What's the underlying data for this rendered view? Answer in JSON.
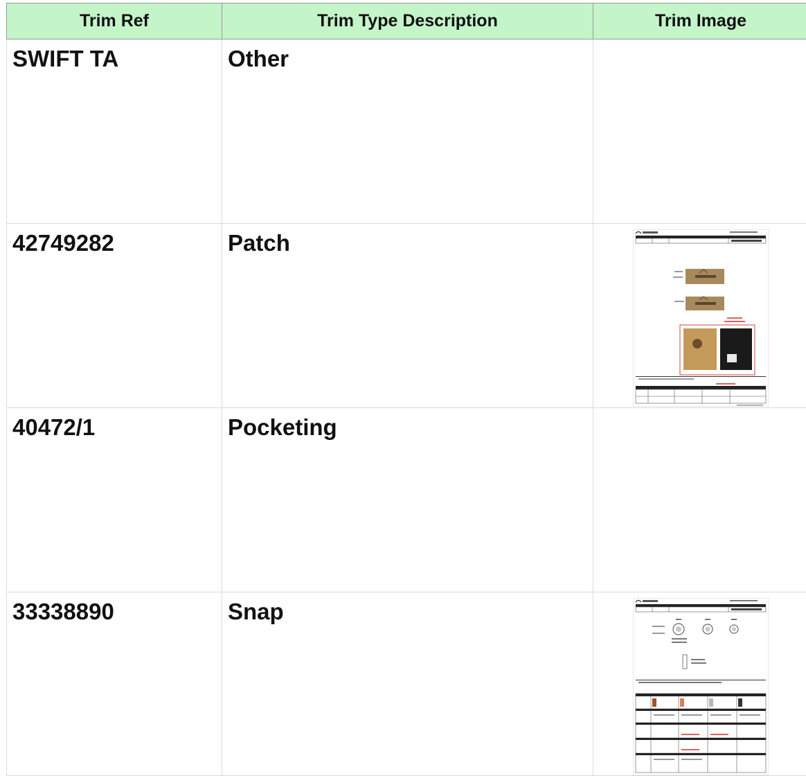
{
  "table": {
    "headers": [
      "Trim Ref",
      "Trim Type Description",
      "Trim Image"
    ],
    "rows": [
      {
        "ref": "SWIFT TA",
        "description": "Other",
        "image": null
      },
      {
        "ref": "42749282",
        "description": "Patch",
        "image": "artwork-sheet-thumbnail"
      },
      {
        "ref": "40472/1",
        "description": "Pocketing",
        "image": null
      },
      {
        "ref": "33338890",
        "description": "Snap",
        "image": "artwork-sheet-thumbnail"
      }
    ]
  },
  "colors": {
    "header_bg": "#c4f5c9",
    "grid": "#dadada"
  }
}
